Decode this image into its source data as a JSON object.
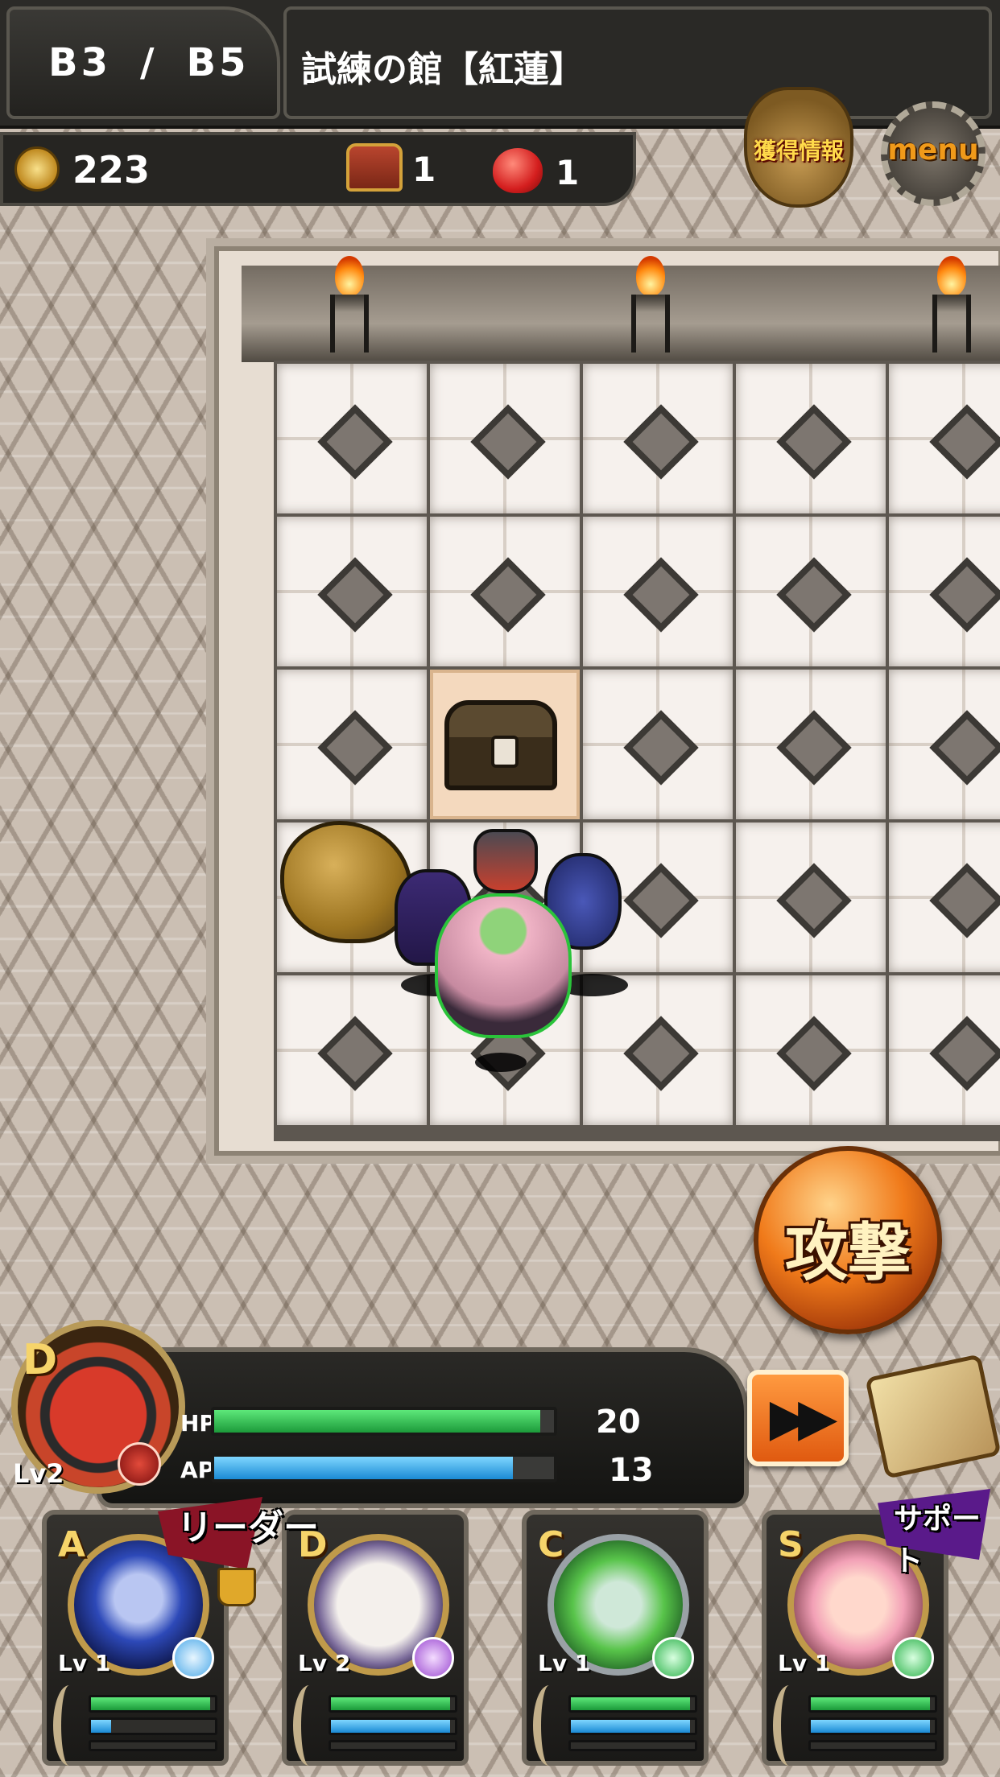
{
  "header": {
    "current_floor": "B3",
    "floor_separator": "/",
    "total_floors": "B5",
    "dungeon_name": "試練の館【紅蓮】"
  },
  "resources": {
    "coins": "223",
    "chests": "1",
    "monsters": "1"
  },
  "buttons": {
    "loot_info": "獲得情報",
    "menu": "menu",
    "attack": "攻撃",
    "fast_forward_icon": "fast-forward-icon",
    "map_icon": "scroll-map-icon"
  },
  "leader_status": {
    "rank": "D",
    "level": "Lv2",
    "hp_label": "HP",
    "hp_value": "20",
    "hp_fill": 0.96,
    "ap_label": "AP",
    "ap_value": "13",
    "ap_fill": 0.88,
    "element_color": "#e24a3a"
  },
  "party": [
    {
      "rank": "A",
      "level": "Lv 1",
      "tag": "リーダー",
      "hp": 0.96,
      "ap": 0.16,
      "xp": 0.0
    },
    {
      "rank": "D",
      "level": "Lv 2",
      "tag": "",
      "hp": 0.96,
      "ap": 0.96,
      "xp": 0.0
    },
    {
      "rank": "C",
      "level": "Lv 1",
      "tag": "",
      "hp": 0.96,
      "ap": 0.96,
      "xp": 0.0
    },
    {
      "rank": "S",
      "level": "Lv 1",
      "tag": "サポート",
      "hp": 0.96,
      "ap": 0.96,
      "xp": 0.0
    }
  ],
  "colors": {
    "hp_green": "#1c9a3a",
    "ap_blue": "#1a8ad4",
    "attack_orange": "#f07a1a",
    "highlight_tile": "#f4d9be"
  }
}
